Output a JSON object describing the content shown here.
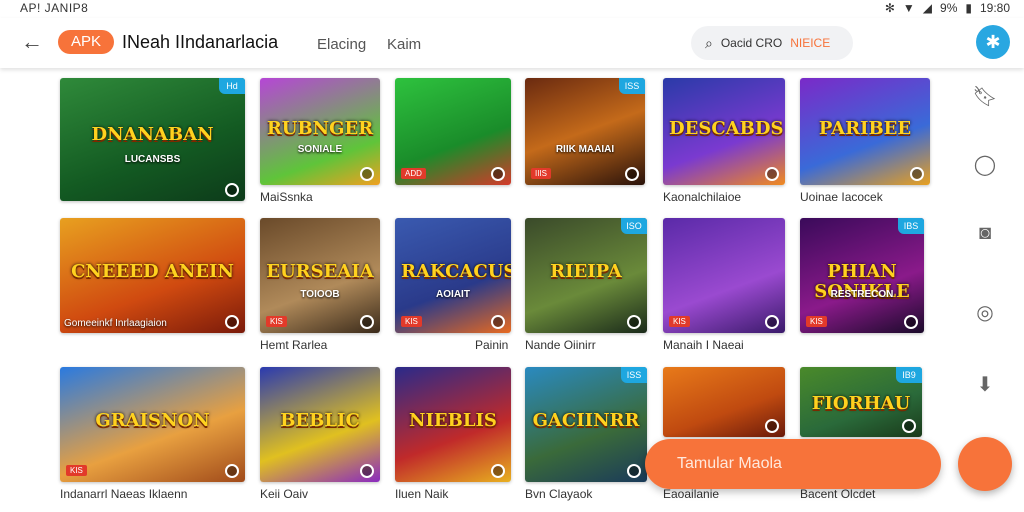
{
  "status_bar": {
    "left_text": "AP! JANIP8",
    "battery": "9%",
    "time": "19:80"
  },
  "app_bar": {
    "badge": "APK",
    "title": "INeah  IIndanarlacia",
    "tabs": [
      "Elacing",
      "Kaim"
    ],
    "search_placeholder": "Oacid CRO",
    "search_accent": "NIEICE"
  },
  "tiles": [
    {
      "art": "DNANABAN",
      "sub": "LUCANSBS",
      "corner": "Hd",
      "tag": "",
      "label": ""
    },
    {
      "art": "RUBNGER",
      "sub": "SONIALE",
      "corner": "",
      "tag": "",
      "label": "MaiSsnka"
    },
    {
      "art": "",
      "sub": "",
      "corner": "",
      "tag": "ADD",
      "label": ""
    },
    {
      "art": "",
      "sub": "RIIK MAAIAI",
      "corner": "ISS",
      "tag": "IIIS",
      "label": ""
    },
    {
      "art": "DESCABDS",
      "sub": "",
      "corner": "",
      "tag": "",
      "label": "Kaonalchilaioe"
    },
    {
      "art": "PARIBEE",
      "sub": "",
      "corner": "",
      "tag": "",
      "label": "Uoinae Iacocek"
    },
    {
      "art": "CNEEED ANEIN",
      "sub": "",
      "corner": "",
      "tag": "",
      "label": "",
      "caption": "Gomeeinkf Inrlaagiaion"
    },
    {
      "art": "EURSEAIA",
      "sub": "TOIOOB",
      "corner": "",
      "tag": "KIS",
      "label": "Hemt Rarlea"
    },
    {
      "art": "RAKCACUS",
      "sub": "AOIAIT",
      "corner": "",
      "tag": "KIS",
      "label": "Painin"
    },
    {
      "art": "RIEIPA",
      "sub": "",
      "corner": "ISO",
      "tag": "",
      "label": "Nande Oiinirr"
    },
    {
      "art": "",
      "sub": "",
      "corner": "",
      "tag": "KIS",
      "label": "Manaih I Naeai"
    },
    {
      "art": "PHIAN SONIKLE",
      "sub": "RESTRECON",
      "corner": "IBS",
      "tag": "KIS",
      "label": ""
    },
    {
      "art": "GRAISNON",
      "sub": "",
      "corner": "",
      "tag": "KIS",
      "label": "Indanarrl Naeas Iklaenn"
    },
    {
      "art": "BEBLIC",
      "sub": "",
      "corner": "",
      "tag": "",
      "label": "Keii Oaiv"
    },
    {
      "art": "NIEBLIS",
      "sub": "",
      "corner": "",
      "tag": "",
      "label": "Iluen Naik"
    },
    {
      "art": "GACIINRR",
      "sub": "",
      "corner": "ISS",
      "tag": "",
      "label": "Bvn Clayaok"
    },
    {
      "art": "",
      "sub": "",
      "corner": "",
      "tag": "",
      "label": "Eaoailanie"
    },
    {
      "art": "FIORHAU",
      "sub": "",
      "corner": "IB9",
      "tag": "",
      "label": "Bacent Olcdet"
    }
  ],
  "side_icons": [
    "bookmark-icon",
    "comment-icon",
    "camera-icon",
    "chat-icon",
    "download-icon"
  ],
  "snackbar": {
    "label": "Tamular Maola"
  },
  "colors": {
    "accent": "#f7733a",
    "blue": "#29a7e1"
  }
}
